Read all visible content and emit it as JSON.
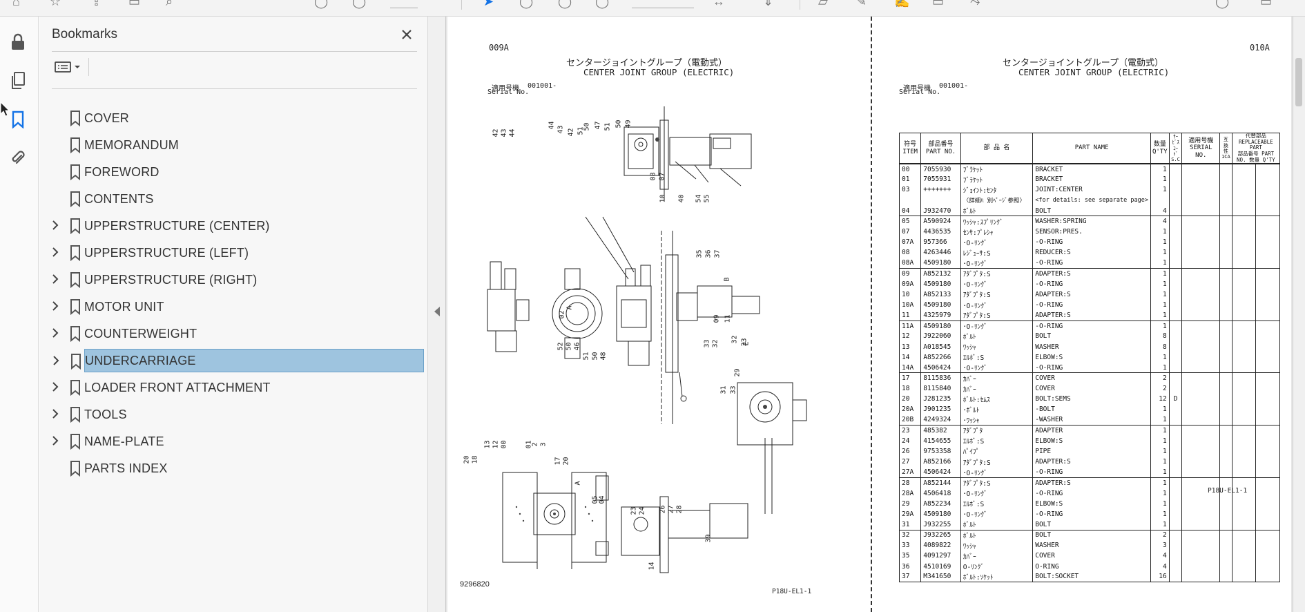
{
  "panel": {
    "title": "Bookmarks",
    "bookmarks": [
      {
        "label": "COVER",
        "expandable": false,
        "selected": false
      },
      {
        "label": "MEMORANDUM",
        "expandable": false,
        "selected": false
      },
      {
        "label": "FOREWORD",
        "expandable": false,
        "selected": false
      },
      {
        "label": "CONTENTS",
        "expandable": false,
        "selected": false
      },
      {
        "label": "UPPERSTRUCTURE (CENTER)",
        "expandable": true,
        "selected": false
      },
      {
        "label": "UPPERSTRUCTURE (LEFT)",
        "expandable": true,
        "selected": false
      },
      {
        "label": "UPPERSTRUCTURE (RIGHT)",
        "expandable": true,
        "selected": false
      },
      {
        "label": "MOTOR UNIT",
        "expandable": true,
        "selected": false
      },
      {
        "label": "COUNTERWEIGHT",
        "expandable": true,
        "selected": false
      },
      {
        "label": "UNDERCARRIAGE",
        "expandable": true,
        "selected": true
      },
      {
        "label": "LOADER FRONT ATTACHMENT",
        "expandable": true,
        "selected": false
      },
      {
        "label": "TOOLS",
        "expandable": true,
        "selected": false
      },
      {
        "label": "NAME-PLATE",
        "expandable": true,
        "selected": false
      },
      {
        "label": "PARTS INDEX",
        "expandable": false,
        "selected": false
      }
    ]
  },
  "colors": {
    "accent": "#1473e6",
    "selection": "#9ec4df"
  },
  "rail_icons": [
    "lock-icon",
    "copy-pages-icon",
    "bookmark-icon",
    "attachment-icon"
  ],
  "left_page": {
    "page_code": "009A",
    "title_jp": "センタージョイントグループ（電動式）",
    "title_en": "CENTER JOINT GROUP (ELECTRIC)",
    "serial_label_jp": "適用号機",
    "serial_value": "001001-",
    "serial_label_en": "Serial No.",
    "drawing_no": "9296820",
    "footer": "P18U-EL1-1",
    "callouts": [
      "08",
      "07",
      "10",
      "40",
      "54",
      "55",
      "42",
      "43",
      "44",
      "44",
      "43",
      "42",
      "51",
      "50",
      "47",
      "51",
      "50",
      "49",
      "35",
      "36",
      "37",
      "B",
      "02",
      "A",
      "52",
      "50",
      "46",
      "51",
      "50",
      "48",
      "09",
      "11",
      "32",
      "33",
      "33",
      "32",
      "E",
      "29",
      "31",
      "33",
      "20",
      "18",
      "13",
      "12",
      "00",
      "01",
      "2",
      "3",
      "17",
      "20",
      "A",
      "05",
      "04",
      "23",
      "24",
      "26",
      "27",
      "28",
      "14",
      "39"
    ]
  },
  "right_page": {
    "page_code": "010A",
    "title_jp": "センタージョイントグループ（電動式）",
    "title_en": "CENTER JOINT GROUP (ELECTRIC)",
    "serial_label_jp": "適用号機",
    "serial_value": "001001-",
    "serial_label_en": "Serial No.",
    "footer": "P18U-EL1-1",
    "headers": {
      "item_jp": "符号",
      "item_en": "ITEM",
      "partno_jp": "部品番号",
      "partno_en": "PART NO.",
      "name_jp": "部 品 名",
      "name_en": "PART NAME",
      "qty_jp": "数量",
      "qty_en": "Q'TY",
      "sc_jp": "ｻｰﾋﾞｽ ｺｰﾄﾞ",
      "sc_en": "S.C",
      "serial_jp": "適用号機",
      "serial_en": "SERIAL NO.",
      "compat_jp": "互換性",
      "compat_en": "1CA",
      "repl_jp": "代替部品",
      "repl_en": "REPLACEABLE PART",
      "repl_partno": "部品番号 PART NO.",
      "repl_qty": "数量 Q'TY"
    },
    "rows": [
      {
        "item": "00",
        "part": "7055930",
        "jp": "ﾌﾞﾗｹｯﾄ",
        "en": "BRACKET",
        "qty": "1",
        "sc": ""
      },
      {
        "item": "01",
        "part": "7055931",
        "jp": "ﾌﾞﾗｹｯﾄ",
        "en": "BRACKET",
        "qty": "1",
        "sc": ""
      },
      {
        "item": "03",
        "part": "+++++++",
        "jp": "ｼﾞｮｲﾝﾄ:ｾﾝﾀ",
        "en": "JOINT:CENTER",
        "qty": "1",
        "sc": ""
      },
      {
        "item": "",
        "part": "",
        "jp": "〈詳細ﾊ 別ﾍﾟｰｼﾞ参照〉",
        "en": "<for details: see separate page>",
        "qty": "",
        "sc": ""
      },
      {
        "item": "04",
        "part": "J932470",
        "jp": "ﾎﾞﾙﾄ",
        "en": "BOLT",
        "qty": "4",
        "sc": "",
        "grp": true
      },
      {
        "item": "05",
        "part": "A590924",
        "jp": "ﾜｯｼｬ:ｽﾌﾟﾘﾝｸﾞ",
        "en": "WASHER:SPRING",
        "qty": "4",
        "sc": ""
      },
      {
        "item": "07",
        "part": "4436535",
        "jp": "ｾﾝｻ:ﾌﾟﾚｼｬ",
        "en": "SENSOR:PRES.",
        "qty": "1",
        "sc": ""
      },
      {
        "item": "07A",
        "part": "957366",
        "jp": "･O-ﾘﾝｸﾞ",
        "en": "-O-RING",
        "qty": "1",
        "sc": ""
      },
      {
        "item": "08",
        "part": "4263446",
        "jp": "ﾚｼﾞｭｰｻ:S",
        "en": "REDUCER:S",
        "qty": "1",
        "sc": ""
      },
      {
        "item": "08A",
        "part": "4509180",
        "jp": "･O-ﾘﾝｸﾞ",
        "en": "-O-RING",
        "qty": "1",
        "sc": "",
        "grp": true
      },
      {
        "item": "09",
        "part": "A852132",
        "jp": "ｱﾀﾞﾌﾟﾀ:S",
        "en": "ADAPTER:S",
        "qty": "1",
        "sc": ""
      },
      {
        "item": "09A",
        "part": "4509180",
        "jp": "･O-ﾘﾝｸﾞ",
        "en": "-O-RING",
        "qty": "1",
        "sc": ""
      },
      {
        "item": "10",
        "part": "A852133",
        "jp": "ｱﾀﾞﾌﾟﾀ:S",
        "en": "ADAPTER:S",
        "qty": "1",
        "sc": ""
      },
      {
        "item": "10A",
        "part": "4509180",
        "jp": "･O-ﾘﾝｸﾞ",
        "en": "-O-RING",
        "qty": "1",
        "sc": ""
      },
      {
        "item": "11",
        "part": "4325979",
        "jp": "ｱﾀﾞﾌﾟﾀ:S",
        "en": "ADAPTER:S",
        "qty": "1",
        "sc": "",
        "grp": true
      },
      {
        "item": "11A",
        "part": "4509180",
        "jp": "･O-ﾘﾝｸﾞ",
        "en": "-O-RING",
        "qty": "1",
        "sc": ""
      },
      {
        "item": "12",
        "part": "J922060",
        "jp": "ﾎﾞﾙﾄ",
        "en": "BOLT",
        "qty": "8",
        "sc": ""
      },
      {
        "item": "13",
        "part": "A018545",
        "jp": "ﾜｯｼｬ",
        "en": "WASHER",
        "qty": "8",
        "sc": ""
      },
      {
        "item": "14",
        "part": "A852266",
        "jp": "ｴﾙﾎﾞ:S",
        "en": "ELBOW:S",
        "qty": "1",
        "sc": ""
      },
      {
        "item": "14A",
        "part": "4506424",
        "jp": "･O-ﾘﾝｸﾞ",
        "en": "-O-RING",
        "qty": "1",
        "sc": "",
        "grp": true
      },
      {
        "item": "17",
        "part": "8115836",
        "jp": "ｶﾊﾞｰ",
        "en": "COVER",
        "qty": "2",
        "sc": ""
      },
      {
        "item": "18",
        "part": "8115840",
        "jp": "ｶﾊﾞｰ",
        "en": "COVER",
        "qty": "2",
        "sc": ""
      },
      {
        "item": "20",
        "part": "J281235",
        "jp": "ﾎﾞﾙﾄ:ｾﾑｽ",
        "en": "BOLT:SEMS",
        "qty": "12",
        "sc": "D"
      },
      {
        "item": "20A",
        "part": "J901235",
        "jp": "･ﾎﾞﾙﾄ",
        "en": "-BOLT",
        "qty": "1",
        "sc": ""
      },
      {
        "item": "20B",
        "part": "4249324",
        "jp": "･ﾜｯｼｬ",
        "en": "-WASHER",
        "qty": "1",
        "sc": "",
        "grp": true
      },
      {
        "item": "23",
        "part": "485382",
        "jp": "ｱﾀﾞﾌﾟﾀ",
        "en": "ADAPTER",
        "qty": "1",
        "sc": ""
      },
      {
        "item": "24",
        "part": "4154655",
        "jp": "ｴﾙﾎﾞ:S",
        "en": "ELBOW:S",
        "qty": "1",
        "sc": ""
      },
      {
        "item": "26",
        "part": "9753358",
        "jp": "ﾊﾟｲﾌﾟ",
        "en": "PIPE",
        "qty": "1",
        "sc": ""
      },
      {
        "item": "27",
        "part": "A852166",
        "jp": "ｱﾀﾞﾌﾟﾀ:S",
        "en": "ADAPTER:S",
        "qty": "1",
        "sc": ""
      },
      {
        "item": "27A",
        "part": "4506424",
        "jp": "･O-ﾘﾝｸﾞ",
        "en": "-O-RING",
        "qty": "1",
        "sc": "",
        "grp": true
      },
      {
        "item": "28",
        "part": "A852144",
        "jp": "ｱﾀﾞﾌﾟﾀ:S",
        "en": "ADAPTER:S",
        "qty": "1",
        "sc": ""
      },
      {
        "item": "28A",
        "part": "4506418",
        "jp": "･O-ﾘﾝｸﾞ",
        "en": "-O-RING",
        "qty": "1",
        "sc": ""
      },
      {
        "item": "29",
        "part": "A852234",
        "jp": "ｴﾙﾎﾞ:S",
        "en": "ELBOW:S",
        "qty": "1",
        "sc": ""
      },
      {
        "item": "29A",
        "part": "4509180",
        "jp": "･O-ﾘﾝｸﾞ",
        "en": "-O-RING",
        "qty": "1",
        "sc": ""
      },
      {
        "item": "31",
        "part": "J932255",
        "jp": "ﾎﾞﾙﾄ",
        "en": "BOLT",
        "qty": "1",
        "sc": "",
        "grp": true
      },
      {
        "item": "32",
        "part": "J932265",
        "jp": "ﾎﾞﾙﾄ",
        "en": "BOLT",
        "qty": "2",
        "sc": ""
      },
      {
        "item": "33",
        "part": "4089822",
        "jp": "ﾜｯｼｬ",
        "en": "WASHER",
        "qty": "3",
        "sc": ""
      },
      {
        "item": "35",
        "part": "4091297",
        "jp": "ｶﾊﾞｰ",
        "en": "COVER",
        "qty": "4",
        "sc": ""
      },
      {
        "item": "36",
        "part": "4510169",
        "jp": "O-ﾘﾝｸﾞ",
        "en": "O-RING",
        "qty": "4",
        "sc": ""
      },
      {
        "item": "37",
        "part": "M341650",
        "jp": "ﾎﾞﾙﾄ:ｿｹｯﾄ",
        "en": "BOLT:SOCKET",
        "qty": "16",
        "sc": "",
        "grp": true
      }
    ]
  }
}
